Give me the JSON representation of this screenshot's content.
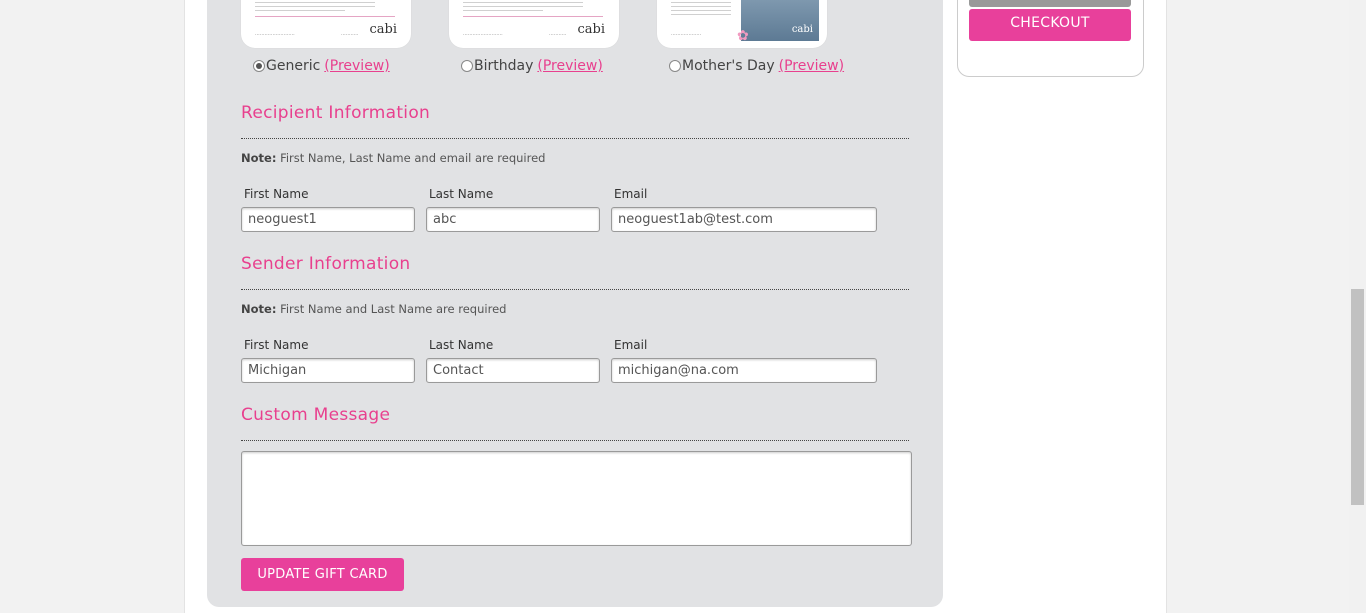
{
  "cards": [
    {
      "label": "Generic",
      "preview": "(Preview)",
      "logo": "cabi",
      "selected": true
    },
    {
      "label": "Birthday",
      "preview": "(Preview)",
      "logo": "cabi",
      "selected": false
    },
    {
      "label": "Mother's Day",
      "preview": "(Preview)",
      "logo": "cabi",
      "selected": false
    }
  ],
  "recipient": {
    "title": "Recipient Information",
    "note_label": "Note:",
    "note_text": "First Name, Last Name and email are required",
    "first_name_label": "First Name",
    "last_name_label": "Last Name",
    "email_label": "Email",
    "first_name": "neoguest1",
    "last_name": "abc",
    "email": "neoguest1ab@test.com"
  },
  "sender": {
    "title": "Sender Information",
    "note_label": "Note:",
    "note_text": "First Name and Last Name are required",
    "first_name_label": "First Name",
    "last_name_label": "Last Name",
    "email_label": "Email",
    "first_name": "Michigan",
    "last_name": "Contact",
    "email": "michigan@na.com"
  },
  "message": {
    "title": "Custom Message",
    "value": ""
  },
  "update_button": "UPDATE GIFT CARD",
  "checkout_button": "CHECKOUT",
  "colors": {
    "accent": "#e8408e",
    "panel": "#e1e2e4"
  }
}
